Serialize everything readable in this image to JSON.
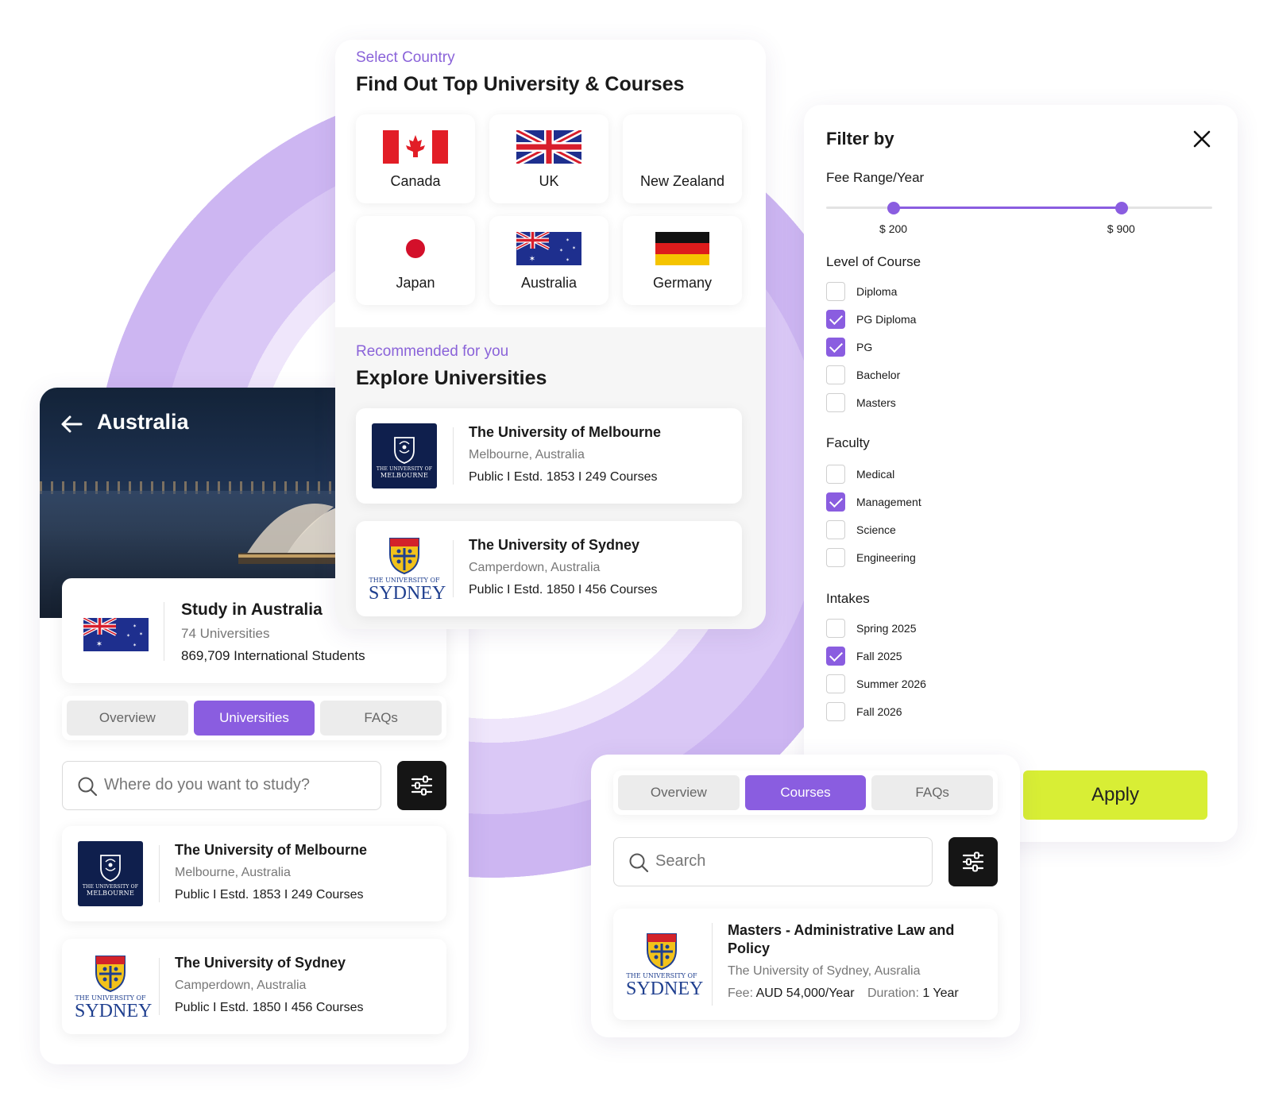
{
  "colors": {
    "accent": "#8a5de0",
    "apply": "#d8ee35",
    "dark_button": "#151515"
  },
  "left_panel": {
    "header_title": "Australia",
    "study": {
      "title": "Study in Australia",
      "universities": "74 Universities",
      "students": "869,709 International Students"
    },
    "tabs": [
      {
        "label": "Overview",
        "active": false
      },
      {
        "label": "Universities",
        "active": true
      },
      {
        "label": "FAQs",
        "active": false
      }
    ],
    "search_placeholder": "Where do you want to study?",
    "universities": [
      {
        "name": "The University of Melbourne",
        "location": "Melbourne, Australia",
        "meta": "Public I Estd. 1853 I 249 Courses",
        "logo": "melbourne-logo"
      },
      {
        "name": "The University of Sydney",
        "location": "Camperdown, Australia",
        "meta": "Public I Estd. 1850 I 456 Courses",
        "logo": "sydney-logo"
      }
    ]
  },
  "country_panel": {
    "eyebrow": "Select Country",
    "title": "Find Out Top University & Courses",
    "countries": [
      {
        "name": "Canada",
        "flag": "canada-flag"
      },
      {
        "name": "UK",
        "flag": "uk-flag"
      },
      {
        "name": "New Zealand",
        "flag": ""
      },
      {
        "name": "Japan",
        "flag": "japan-flag"
      },
      {
        "name": "Australia",
        "flag": "australia-flag"
      },
      {
        "name": "Germany",
        "flag": "germany-flag"
      }
    ],
    "recommended_eyebrow": "Recommended for you",
    "recommended_title": "Explore Universities",
    "universities": [
      {
        "name": "The University of Melbourne",
        "location": "Melbourne, Australia",
        "meta": "Public I Estd. 1853 I 249 Courses"
      },
      {
        "name": "The University of Sydney",
        "location": "Camperdown, Australia",
        "meta": "Public I Estd. 1850 I 456 Courses"
      }
    ]
  },
  "logos": {
    "melbourne_small": "THE UNIVERSITY OF",
    "melbourne_big": "MELBOURNE",
    "sydney_small": "THE UNIVERSITY OF",
    "sydney_big": "SYDNEY"
  },
  "filter": {
    "title": "Filter by",
    "fee_label": "Fee Range/Year",
    "fee_min": "$ 200",
    "fee_max": "$ 900",
    "fee_range_fraction": {
      "min": 0.175,
      "max": 0.765
    },
    "level_label": "Level of Course",
    "levels": [
      {
        "label": "Diploma",
        "checked": false
      },
      {
        "label": "PG Diploma",
        "checked": true
      },
      {
        "label": "PG",
        "checked": true
      },
      {
        "label": "Bachelor",
        "checked": false
      },
      {
        "label": "Masters",
        "checked": false
      }
    ],
    "faculty_label": "Faculty",
    "faculties": [
      {
        "label": "Medical",
        "checked": false
      },
      {
        "label": "Management",
        "checked": true
      },
      {
        "label": "Science",
        "checked": false
      },
      {
        "label": "Engineering",
        "checked": false
      }
    ],
    "intakes_label": "Intakes",
    "intakes": [
      {
        "label": "Spring 2025",
        "checked": false
      },
      {
        "label": "Fall 2025",
        "checked": true
      },
      {
        "label": "Summer 2026",
        "checked": false
      },
      {
        "label": "Fall 2026",
        "checked": false
      }
    ],
    "apply_label": "Apply"
  },
  "courses_panel": {
    "tabs": [
      {
        "label": "Overview",
        "active": false
      },
      {
        "label": "Courses",
        "active": true
      },
      {
        "label": "FAQs",
        "active": false
      }
    ],
    "search_placeholder": "Search",
    "course": {
      "title": "Masters - Administrative Law  and Policy",
      "university": "The University of Sydney, Ausralia",
      "fee_label": "Fee:",
      "fee_value": "AUD 54,000/Year",
      "duration_label": "Duration:",
      "duration_value": "1 Year"
    }
  }
}
